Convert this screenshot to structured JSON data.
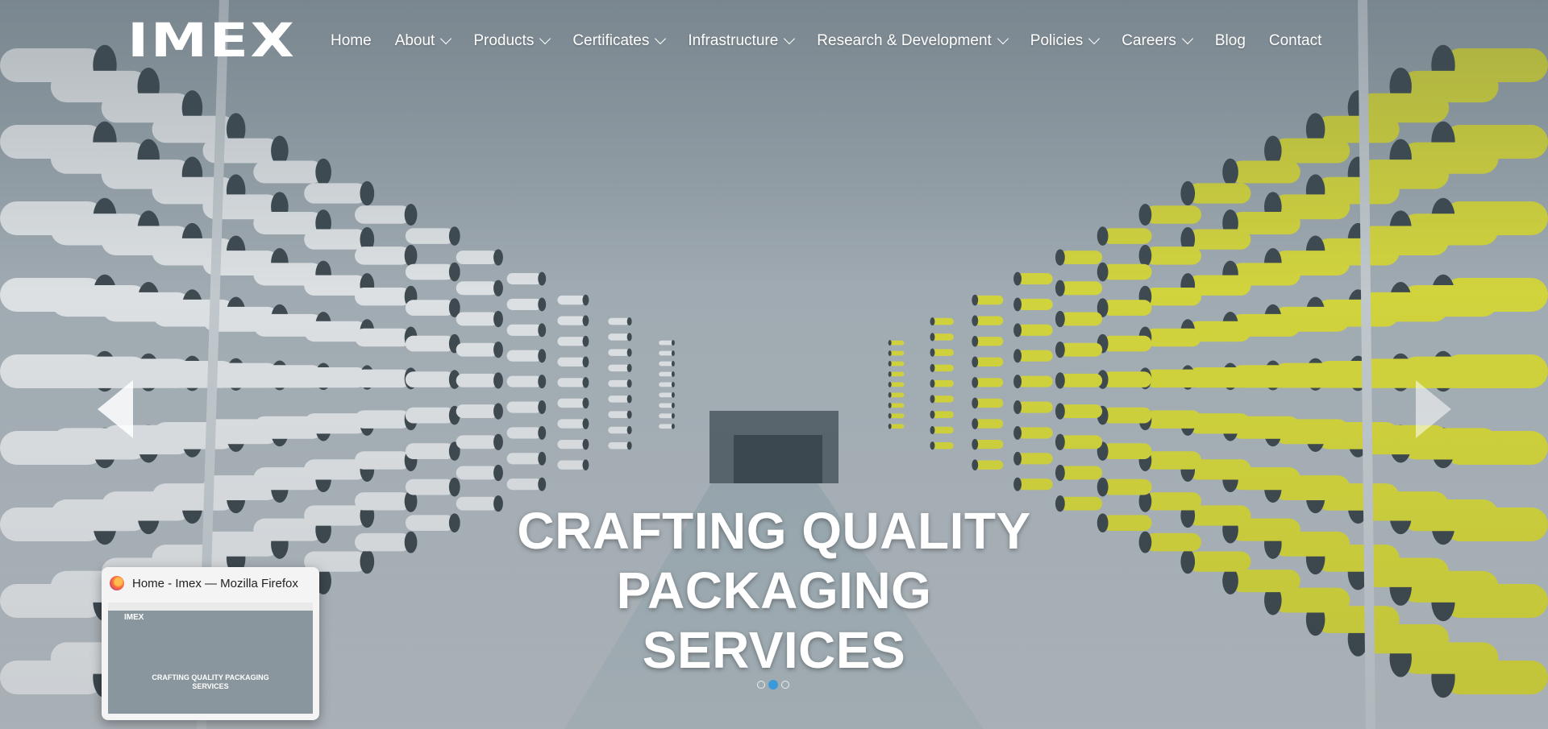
{
  "brand": {
    "logo_text": "IMEX"
  },
  "nav": {
    "items": [
      {
        "label": "Home",
        "has_dropdown": false
      },
      {
        "label": "About",
        "has_dropdown": true
      },
      {
        "label": "Products",
        "has_dropdown": true
      },
      {
        "label": "Certificates",
        "has_dropdown": true
      },
      {
        "label": "Infrastructure",
        "has_dropdown": true
      },
      {
        "label": "Research & Development",
        "has_dropdown": true
      },
      {
        "label": "Policies",
        "has_dropdown": true
      },
      {
        "label": "Careers",
        "has_dropdown": true
      },
      {
        "label": "Blog",
        "has_dropdown": false
      },
      {
        "label": "Contact",
        "has_dropdown": false
      }
    ]
  },
  "hero": {
    "headline_line1": "CRAFTING QUALITY PACKAGING",
    "headline_line2": "SERVICES",
    "slide_count": 3,
    "active_slide": 2
  },
  "taskbar_preview": {
    "window_title": "Home - Imex — Mozilla Firefox",
    "thumb_logo": "IMEX",
    "thumb_headline_line1": "CRAFTING QUALITY PACKAGING",
    "thumb_headline_line2": "SERVICES"
  },
  "icons": {
    "prev": "chevron-left-icon",
    "next": "chevron-right-icon",
    "browser": "firefox-icon",
    "dropdown": "chevron-down-icon"
  },
  "colors": {
    "text": "#ffffff",
    "spool_white": "#eef1f3",
    "spool_yellow": "#e2e33a",
    "dot_active": "#3a9ad9"
  }
}
